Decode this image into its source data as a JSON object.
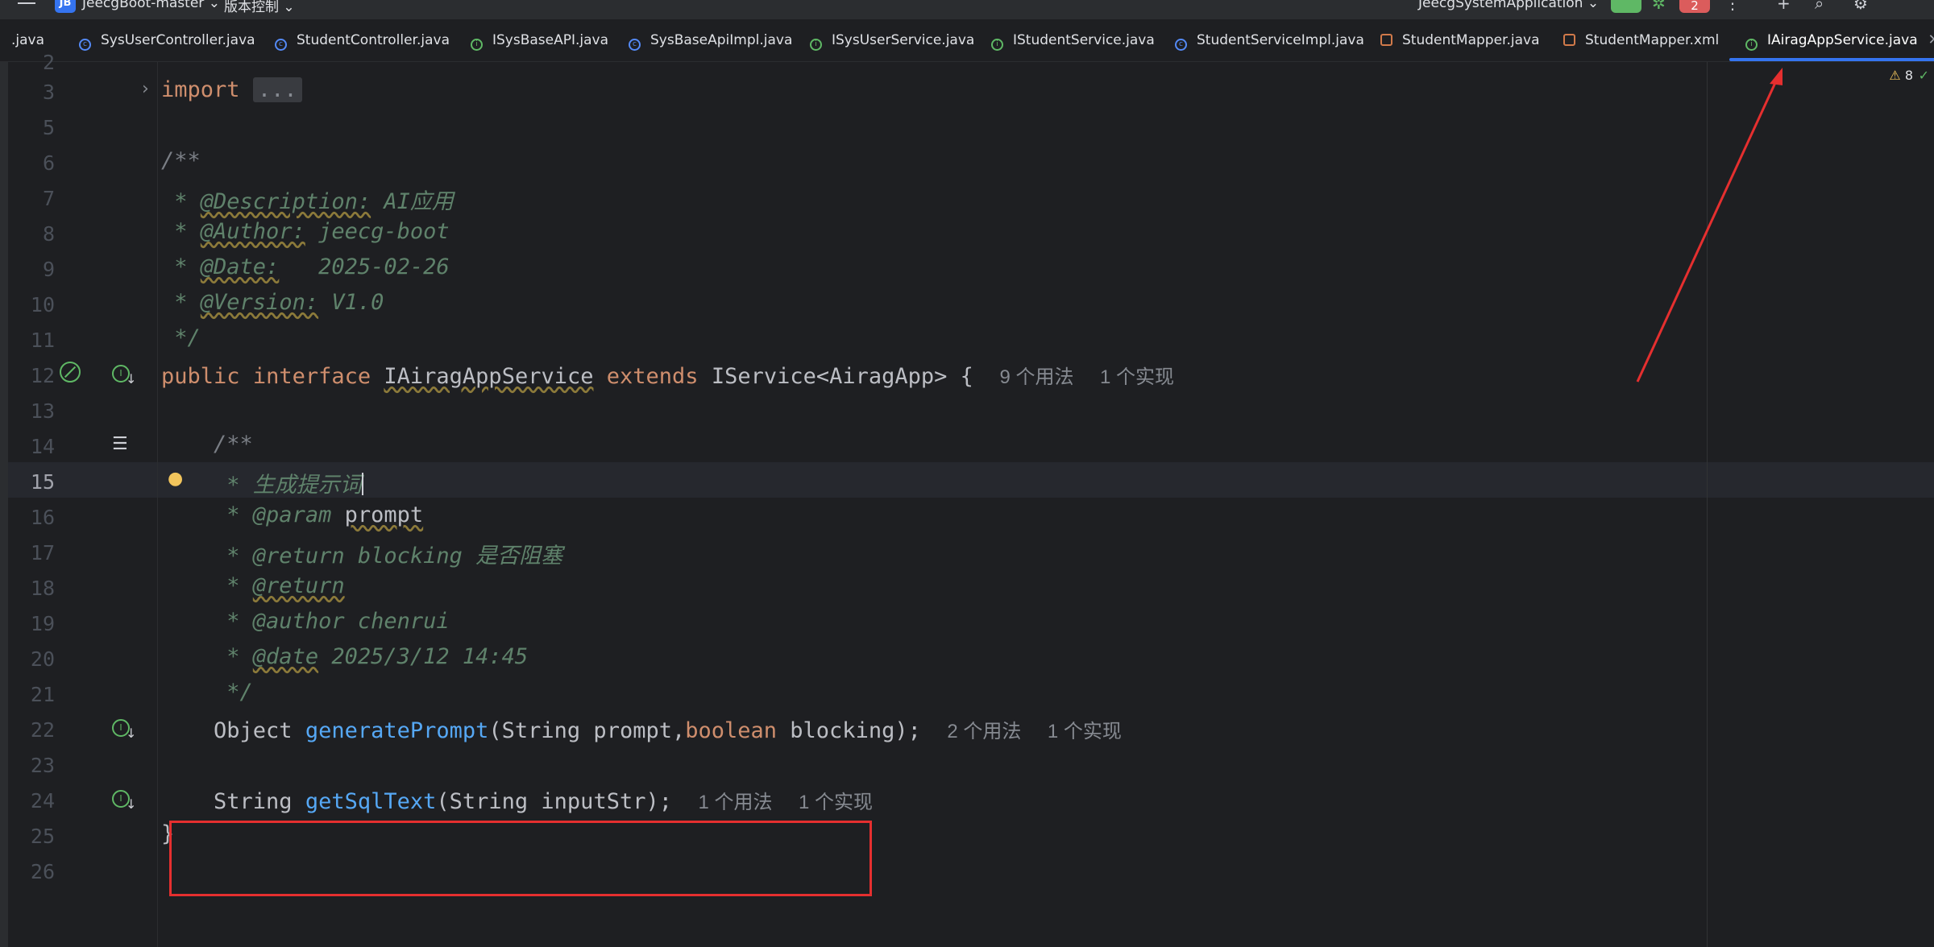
{
  "toolbar": {
    "project_badge": "JB",
    "project_name": "JeecgBoot-master",
    "vcs_label": "版本控制",
    "run_config": "JeecgSystemApplication",
    "notifications": "2"
  },
  "tabs": [
    {
      "label": ".java",
      "icon": "none"
    },
    {
      "label": "SysUserController.java",
      "icon": "class-icon"
    },
    {
      "label": "StudentController.java",
      "icon": "class-icon"
    },
    {
      "label": "ISysBaseAPI.java",
      "icon": "interface-icon"
    },
    {
      "label": "SysBaseApiImpl.java",
      "icon": "class-icon"
    },
    {
      "label": "ISysUserService.java",
      "icon": "interface-icon"
    },
    {
      "label": "IStudentService.java",
      "icon": "interface-icon"
    },
    {
      "label": "StudentServiceImpl.java",
      "icon": "class-icon"
    },
    {
      "label": "StudentMapper.java",
      "icon": "mapper-icon"
    },
    {
      "label": "StudentMapper.xml",
      "icon": "mapper-icon"
    },
    {
      "label": "IAiragAppService.java",
      "icon": "interface-icon",
      "active": true
    }
  ],
  "editor": {
    "warning_count": "8",
    "current_line": 15,
    "lines": {
      "n2": "2",
      "n3": "3",
      "n5": "5",
      "n6": "6",
      "n7": "7",
      "n8": "8",
      "n9": "9",
      "n10": "10",
      "n11": "11",
      "n12": "12",
      "n13": "13",
      "n14": "14",
      "n15": "15",
      "n16": "16",
      "n17": "17",
      "n18": "18",
      "n19": "19",
      "n20": "20",
      "n21": "21",
      "n22": "22",
      "n23": "23",
      "n24": "24",
      "n25": "25",
      "n26": "26"
    },
    "code": {
      "l3_kw": "import",
      "l3_fold": "...",
      "l6": "/**",
      "l7_star": " * ",
      "l7_tag": "@Description:",
      "l7_val": " AI应用",
      "l8_star": " * ",
      "l8_tag": "@Author:",
      "l8_val": " jeecg-boot",
      "l9_star": " * ",
      "l9_tag": "@Date:",
      "l9_val": "   2025-02-26",
      "l10_star": " * ",
      "l10_tag": "@Version:",
      "l10_val": " V1.0",
      "l11": " */",
      "l12_public": "public",
      "l12_interface": "interface",
      "l12_name": "IAiragAppService",
      "l12_extends": "extends",
      "l12_rest": "IService<AiragApp> {",
      "l12_hint_usages": "9 个用法",
      "l12_hint_impl": "1 个实现",
      "l14": "    /**",
      "l15": "     * 生成提示词",
      "l16_star": "     * ",
      "l16_tag": "@param",
      "l16_param": "prompt",
      "l17_star": "     * ",
      "l17_tag": "@return",
      "l17_val": " blocking 是否阻塞",
      "l18_star": "     * ",
      "l18_tag": "@return",
      "l19_star": "     * ",
      "l19_tag": "@author",
      "l19_val": " chenrui",
      "l20_star": "     * ",
      "l20_tag": "@date",
      "l20_val": " 2025/3/12 14:45",
      "l21": "     */",
      "l22_type": "    Object ",
      "l22_fn": "generatePrompt",
      "l22_args1": "(String prompt,",
      "l22_kw": "boolean",
      "l22_args2": " blocking);",
      "l22_hint_usages": "2 个用法",
      "l22_hint_impl": "1 个实现",
      "l24_type": "    String ",
      "l24_fn": "getSqlText",
      "l24_args": "(String inputStr);",
      "l24_hint_usages": "1 个用法",
      "l24_hint_impl": "1 个实现",
      "l25": "}"
    }
  },
  "annotation": {
    "color": "#e52f2f"
  }
}
